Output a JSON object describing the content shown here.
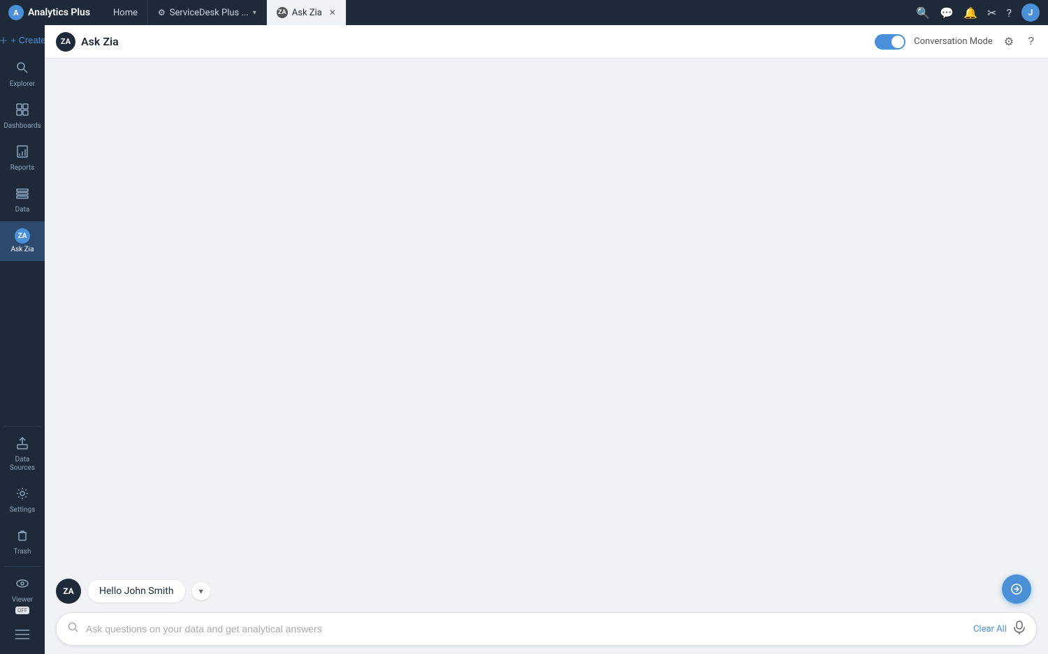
{
  "app": {
    "name": "Analytics Plus",
    "logo_letter": "A"
  },
  "topbar": {
    "tabs": [
      {
        "id": "home",
        "label": "Home",
        "icon": "🏠",
        "active": false,
        "closable": false
      },
      {
        "id": "servicedesk",
        "label": "ServiceDesk Plus ...",
        "icon": "⚙",
        "active": false,
        "closable": false,
        "has_dropdown": true
      },
      {
        "id": "askzia",
        "label": "Ask Zia",
        "icon": "ZA",
        "active": true,
        "closable": true
      }
    ],
    "action_icons": [
      "search",
      "chat",
      "bell",
      "scissors",
      "help",
      "user"
    ]
  },
  "sidebar": {
    "create_label": "+ Create",
    "items": [
      {
        "id": "explorer",
        "label": "Explorer",
        "icon": "🔍",
        "active": false
      },
      {
        "id": "dashboards",
        "label": "Dashboards",
        "icon": "⊞",
        "active": false
      },
      {
        "id": "reports",
        "label": "Reports",
        "icon": "📊",
        "active": false
      },
      {
        "id": "data",
        "label": "Data",
        "icon": "⊟",
        "active": false
      },
      {
        "id": "askzia",
        "label": "Ask Zia",
        "icon": "ZA",
        "active": true
      }
    ],
    "bottom_items": [
      {
        "id": "datasources",
        "label": "Data Sources",
        "icon": "⬆",
        "active": false
      },
      {
        "id": "settings",
        "label": "Settings",
        "icon": "⚙",
        "active": false
      },
      {
        "id": "trash",
        "label": "Trash",
        "icon": "🗑",
        "active": false
      },
      {
        "id": "viewer",
        "label": "Viewer",
        "icon": "👁",
        "active": false,
        "badge": "OFF"
      },
      {
        "id": "menu",
        "label": "",
        "icon": "☰",
        "active": false
      }
    ]
  },
  "content_header": {
    "zia_logo_text": "ZA",
    "title": "Ask Zia",
    "conversation_mode_label": "Conversation Mode",
    "conversation_mode_on": true
  },
  "chat": {
    "greeting_text": "Hello John Smith",
    "send_icon": "💬"
  },
  "input_bar": {
    "placeholder": "Ask questions on your data and get analytical answers",
    "clear_label": "Clear All",
    "search_icon": "🔍",
    "mic_icon": "🎤"
  }
}
